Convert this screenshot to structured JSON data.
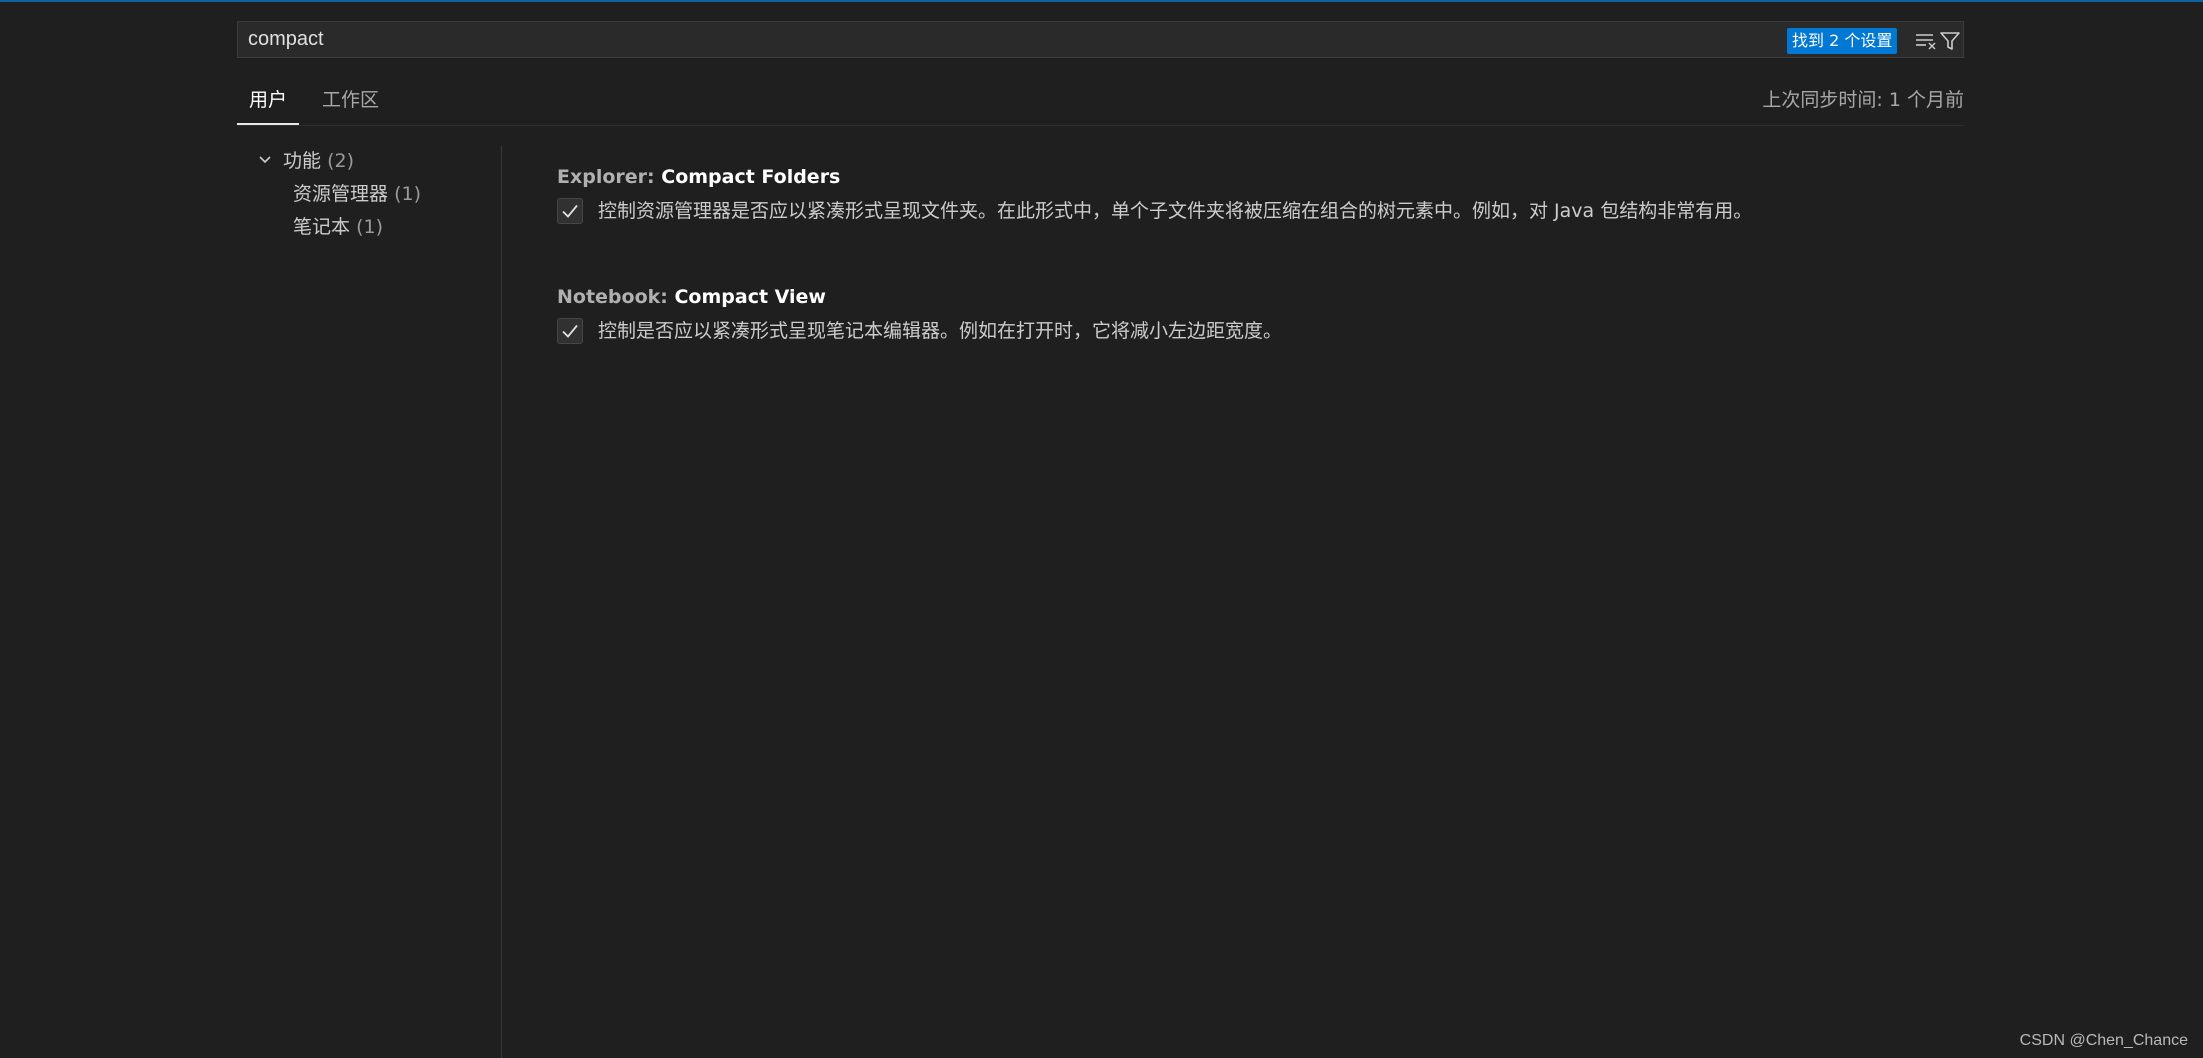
{
  "search": {
    "value": "compact",
    "result_badge": "找到 2 个设置",
    "icons": [
      "clear-filter-icon",
      "filter-icon"
    ]
  },
  "tabs": [
    {
      "label": "用户",
      "active": true
    },
    {
      "label": "工作区",
      "active": false
    }
  ],
  "sync_status": "上次同步时间: 1 个月前",
  "toc": {
    "group": {
      "label": "功能",
      "count": "(2)",
      "expanded": true
    },
    "items": [
      {
        "label": "资源管理器",
        "count": "(1)"
      },
      {
        "label": "笔记本",
        "count": "(1)"
      }
    ]
  },
  "settings": [
    {
      "category": "Explorer: ",
      "name": "Compact Folders",
      "checked": true,
      "description": "控制资源管理器是否应以紧凑形式呈现文件夹。在此形式中，单个子文件夹将被压缩在组合的树元素中。例如，对 Java 包结构非常有用。"
    },
    {
      "category": "Notebook: ",
      "name": "Compact View",
      "checked": true,
      "description": "控制是否应以紧凑形式呈现笔记本编辑器。例如在打开时，它将减小左边距宽度。"
    }
  ],
  "watermark": "CSDN @Chen_Chance",
  "colors": {
    "background": "#1f1f1f",
    "accent": "#0078d4",
    "top_border": "#0e639c"
  }
}
